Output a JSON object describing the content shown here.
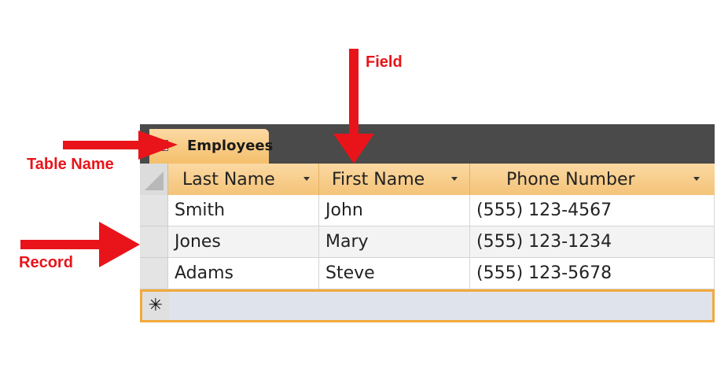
{
  "annotations": {
    "field": "Field",
    "table_name": "Table Name",
    "record": "Record"
  },
  "tab": {
    "label": "Employees"
  },
  "columns": [
    "Last Name",
    "First Name",
    "Phone Number"
  ],
  "rows": [
    [
      "Smith",
      "John",
      "(555) 123-4567"
    ],
    [
      "Jones",
      "Mary",
      "(555) 123-1234"
    ],
    [
      "Adams",
      "Steve",
      "(555) 123-5678"
    ]
  ],
  "new_row_marker": "✳",
  "colors": {
    "arrow": "#e8141a",
    "tab_orange": "#f4bf6b",
    "dark_bar": "#4a4a4a",
    "new_row_border": "#f2a93b"
  }
}
